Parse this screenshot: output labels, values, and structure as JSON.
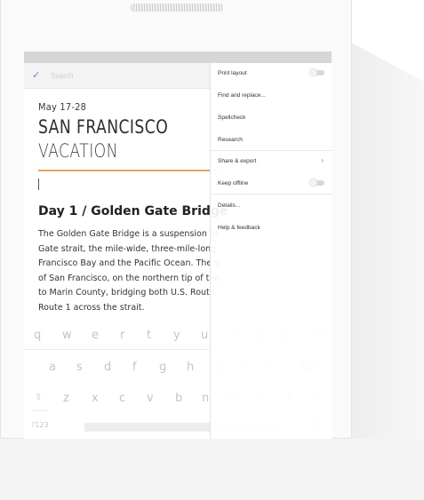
{
  "toolbar": {
    "search_placeholder": "Search",
    "check_icon": "check-icon"
  },
  "document": {
    "date": "May 17-28",
    "title_line1": "SAN FRANCISCO",
    "title_line2": "VACATION",
    "heading": "Day 1 / Golden Gate Bridge",
    "paragraph_lines": [
      "The Golden Gate Bridge is a suspension br",
      "Gate strait, the mile-wide, three-mile-long",
      "Francisco Bay and the Pacific Ocean. The s",
      "of San Francisco, on the northern tip of the",
      "to Marin County, bridging both U.S. Route",
      "Route 1 across the strait."
    ],
    "accent_color": "#e6a46a"
  },
  "menu": {
    "items": [
      {
        "label": "Print layout",
        "control": "toggle"
      },
      {
        "label": "Find and replace...",
        "control": ""
      },
      {
        "label": "Spellcheck",
        "control": ""
      },
      {
        "label": "Research",
        "control": ""
      },
      {
        "label": "Share & export",
        "control": "chevron"
      },
      {
        "label": "Keep offline",
        "control": "toggle"
      },
      {
        "label": "Details...",
        "control": ""
      },
      {
        "label": "Help & feedback",
        "control": ""
      }
    ]
  },
  "keyboard": {
    "row1": [
      "q",
      "w",
      "e",
      "r",
      "t",
      "y",
      "u",
      "i",
      "o",
      "p"
    ],
    "row2": [
      "a",
      "s",
      "d",
      "f",
      "g",
      "h",
      "j",
      "k",
      "l"
    ],
    "row3": [
      "z",
      "x",
      "c",
      "v",
      "b",
      "n",
      "m",
      "!",
      "?"
    ],
    "mode_key": "?123",
    "emoji_key": "☺"
  }
}
